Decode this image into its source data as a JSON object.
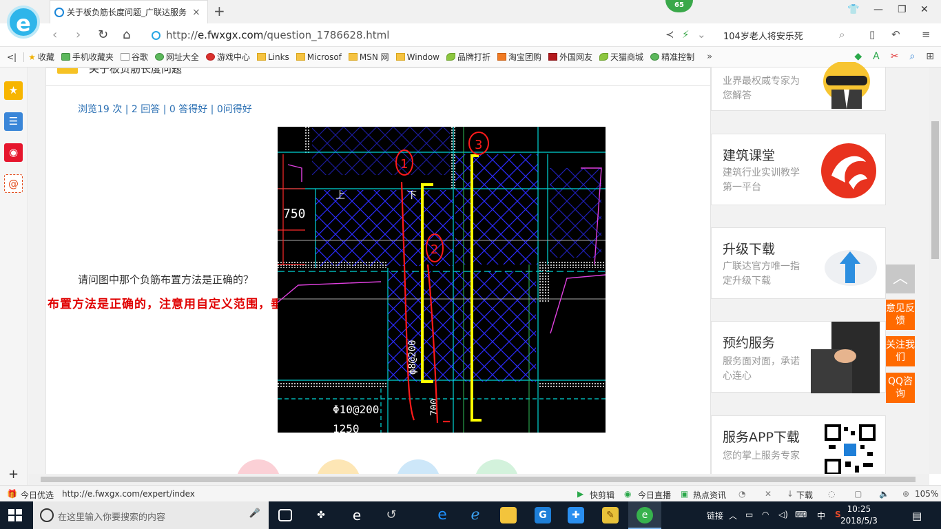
{
  "browser": {
    "tab_title": "关于板负筋长度问题_广联达服务",
    "tab_close": "×",
    "new_tab": "+",
    "badge_count": "65",
    "url": "http://e.fwxgx.com/question_1786628.html",
    "url_domain": "e.fwxgx.com",
    "url_prefix": "http://",
    "url_path": "/question_1786628.html",
    "search_text": "104岁老人将安乐死"
  },
  "favorites": [
    {
      "label": "收藏",
      "icon": "star-icon"
    },
    {
      "label": "手机收藏夹",
      "icon": "phone-icon"
    },
    {
      "label": "谷歌",
      "icon": "page-icon"
    },
    {
      "label": "网址大全",
      "icon": "globe-icon"
    },
    {
      "label": "游戏中心",
      "icon": "game-icon"
    },
    {
      "label": "Links",
      "icon": "folder-icon"
    },
    {
      "label": "Microsof",
      "icon": "folder-icon"
    },
    {
      "label": "MSN 网",
      "icon": "folder-icon"
    },
    {
      "label": "Window",
      "icon": "folder-icon"
    },
    {
      "label": "品牌打折",
      "icon": "leaf-icon"
    },
    {
      "label": "淘宝团购",
      "icon": "taobao-icon"
    },
    {
      "label": "外国网友",
      "icon": "flag-icon"
    },
    {
      "label": "天猫商城",
      "icon": "leaf-icon"
    },
    {
      "label": "精准控制",
      "icon": "chat-icon"
    }
  ],
  "favorites_more": "»",
  "question": {
    "title": "关于板负筋长度问题",
    "stats": "浏览19 次 | 2 回答 | 0 答得好 | 0问得好",
    "text": "请问图中那个负筋布置方法是正确的？",
    "answer": "布置方法是正确的，注意用自定义范围，垂直布置"
  },
  "cad": {
    "dim_750": "750",
    "rebar_spec": "Φ10@200",
    "rebar_spec_vertical": "ф8@200",
    "dim_700": "700",
    "dim_1250": "1250",
    "up_label": "上",
    "down_label": "下",
    "circle1": "1",
    "circle2": "2",
    "circle3": "3"
  },
  "right_cards": [
    {
      "title": "",
      "sub": "业界最权威专家为您解答"
    },
    {
      "title": "建筑课堂",
      "sub": "建筑行业实训教学第一平台"
    },
    {
      "title": "升级下载",
      "sub": "广联达官方唯一指定升级下载"
    },
    {
      "title": "预约服务",
      "sub": "服务面对面，承诺心连心"
    },
    {
      "title": "服务APP下载",
      "sub": "您的掌上服务专家"
    }
  ],
  "float_buttons": [
    "意见反馈",
    "关注我们",
    "QQ咨询"
  ],
  "statusbar": {
    "left_label": "今日优选",
    "link_url": "http://e.fwxgx.com/expert/index",
    "quick_cut": "快剪辑",
    "live": "今日直播",
    "hot_news": "热点资讯",
    "download": "下载",
    "zoom": "105%"
  },
  "taskbar": {
    "search_placeholder": "在这里输入你要搜索的内容",
    "links_label": "链接",
    "ime": "中",
    "time": "10:25",
    "date": "2018/5/3"
  },
  "colors": {
    "accent_orange": "#ff6a00",
    "link_blue": "#2a6fb3",
    "answer_red": "#e00000",
    "cad_blue": "#2b2bff",
    "cad_cyan": "#00d7d7",
    "cad_yellow": "#ffff00"
  }
}
